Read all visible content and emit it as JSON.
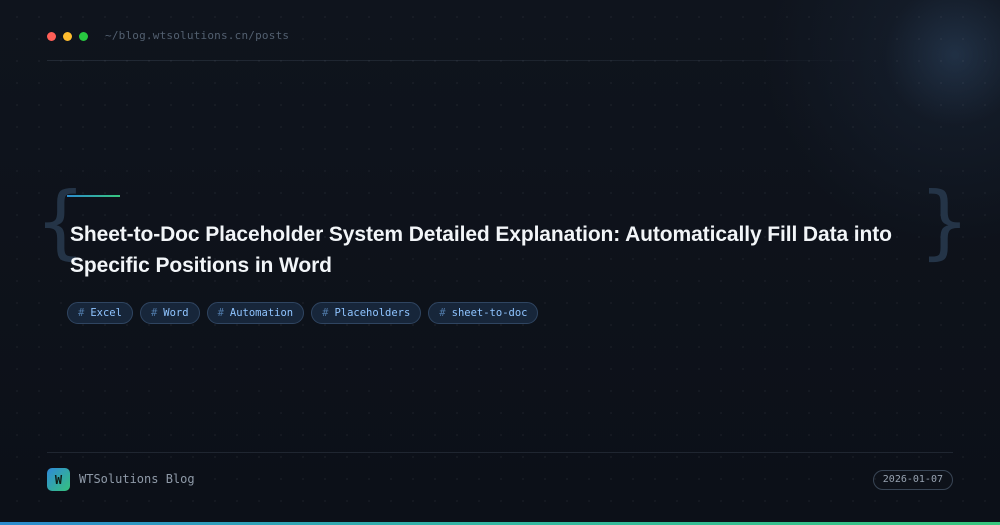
{
  "window": {
    "path": "~/blog.wtsolutions.cn/posts"
  },
  "post": {
    "title": "Sheet-to-Doc Placeholder System Detailed Explanation: Automatically Fill Data into Specific Positions in Word",
    "tags": [
      {
        "hash": "#",
        "label": "Excel"
      },
      {
        "hash": "#",
        "label": "Word"
      },
      {
        "hash": "#",
        "label": "Automation"
      },
      {
        "hash": "#",
        "label": "Placeholders"
      },
      {
        "hash": "#",
        "label": "sheet-to-doc"
      }
    ]
  },
  "decor": {
    "left_brace": "{",
    "right_brace": "}"
  },
  "footer": {
    "logo_letter": "W",
    "site_name": "WTSolutions Blog",
    "date": "2026-01-07"
  },
  "colors": {
    "background": "#0d111a",
    "accent_blue": "#2c8ccf",
    "accent_green": "#37c77e",
    "tag_text": "#8fc4ff"
  }
}
